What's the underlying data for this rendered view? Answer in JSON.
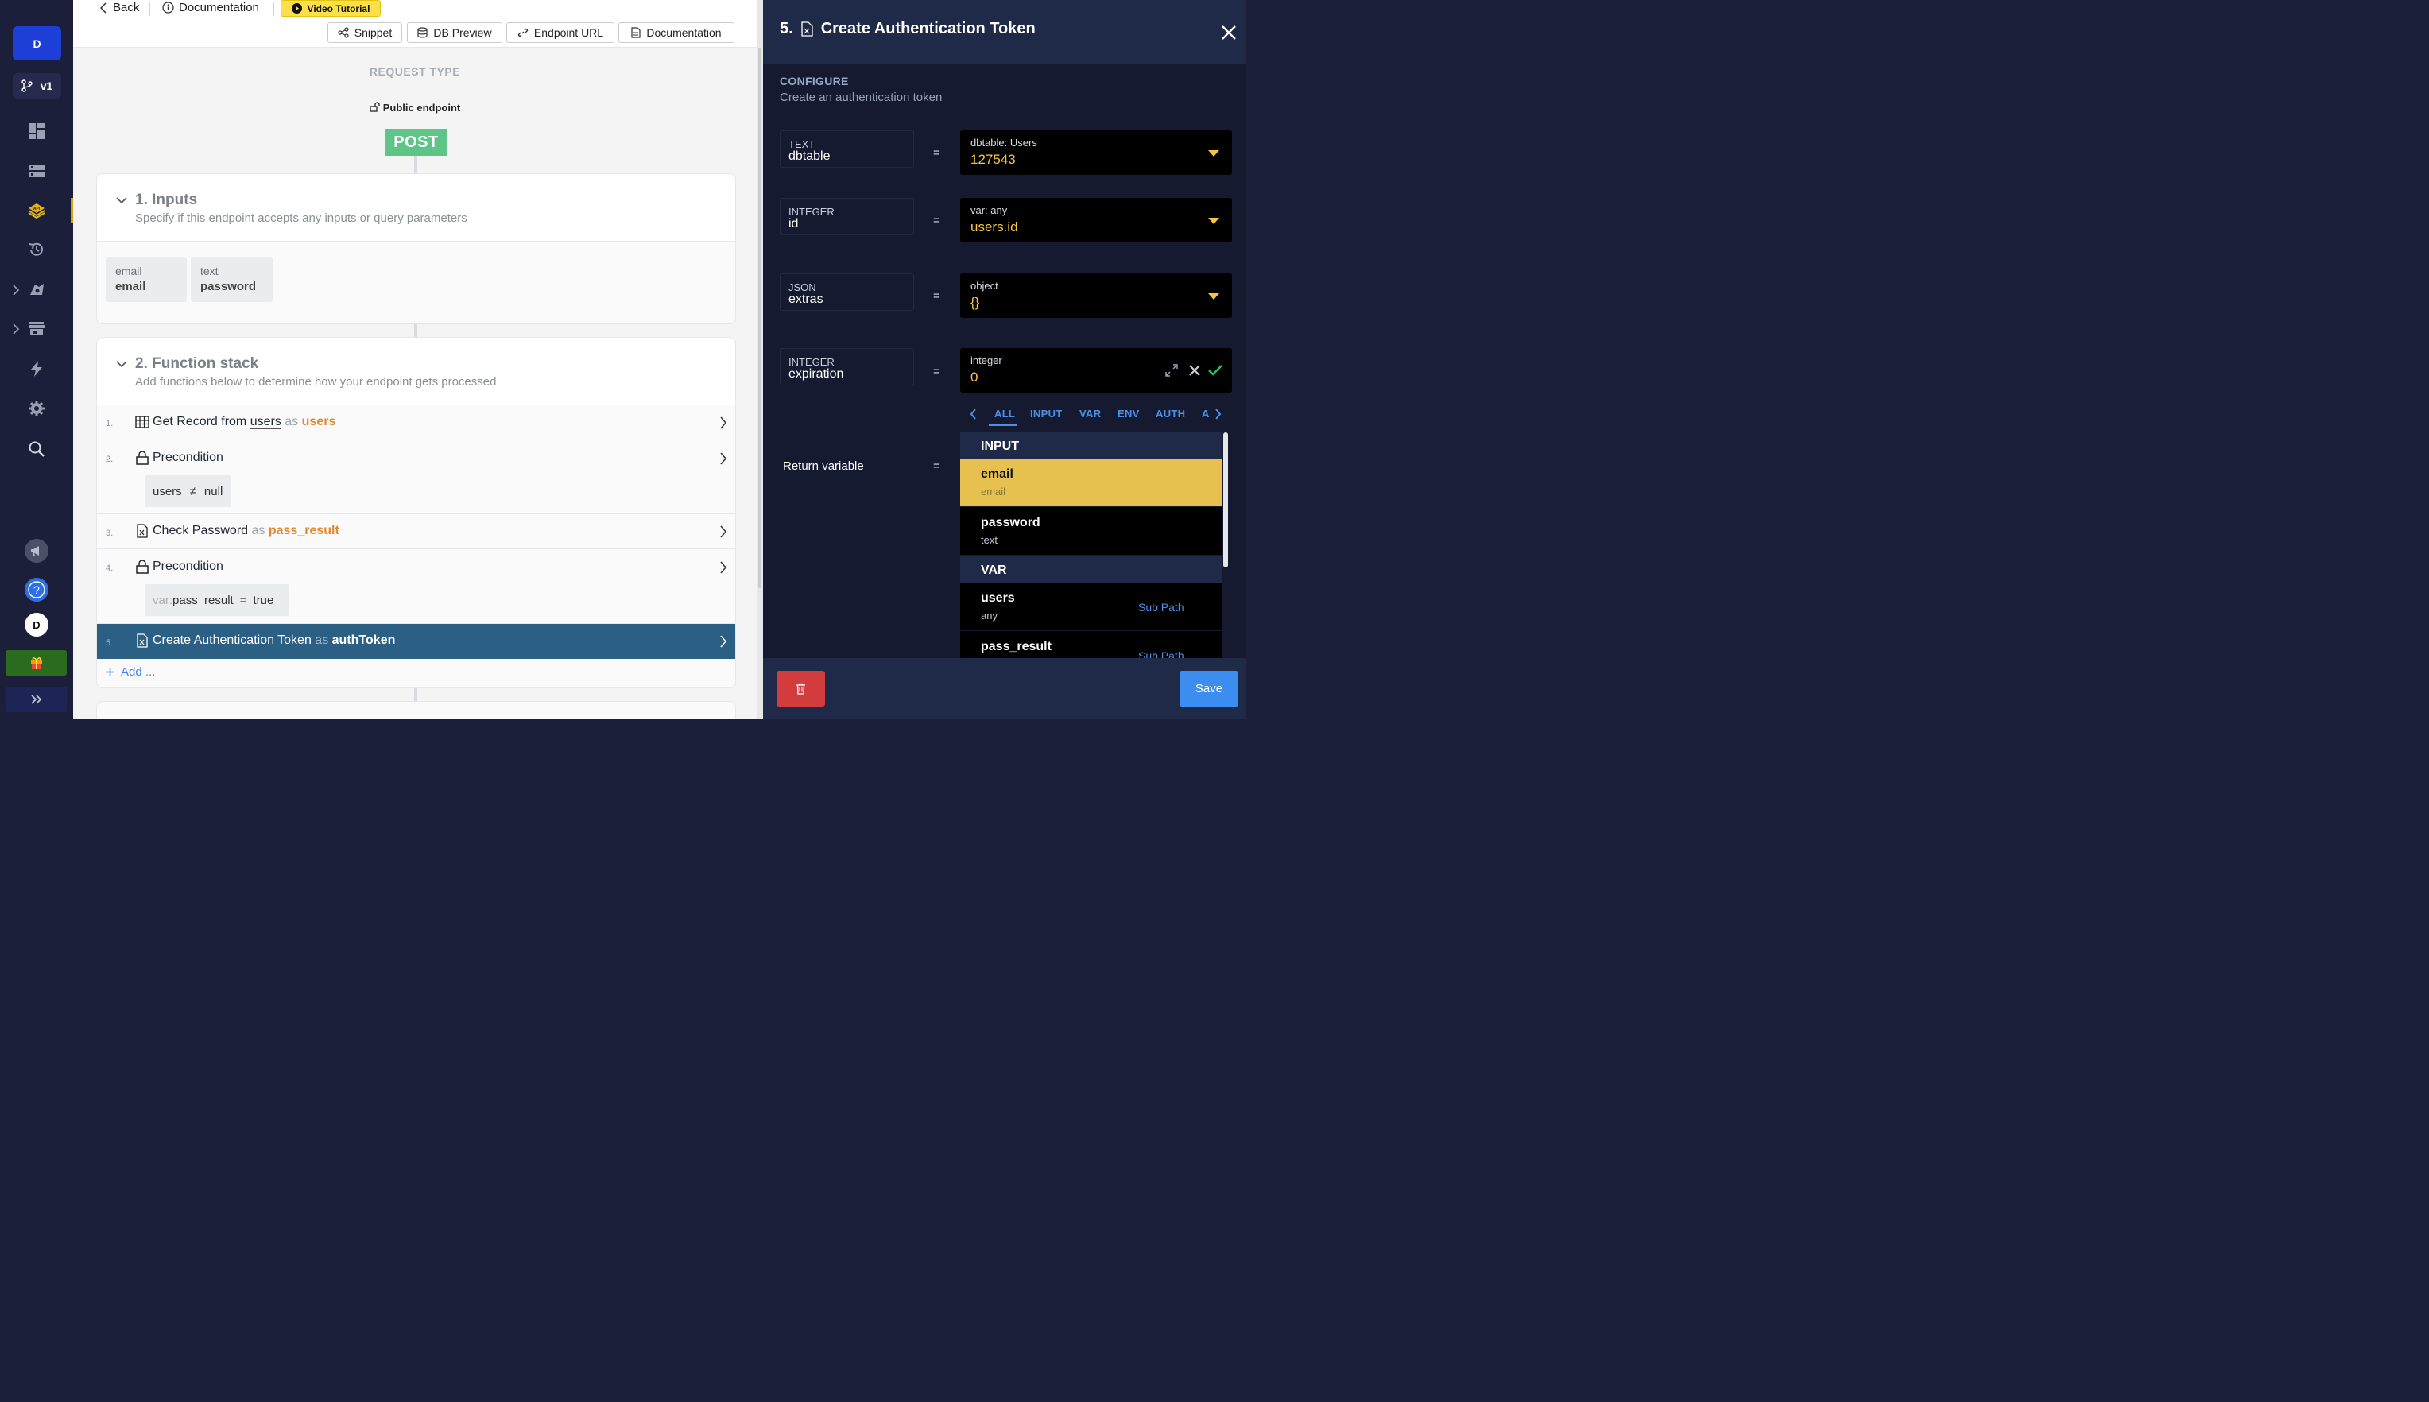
{
  "rail": {
    "avatar_initial": "D",
    "branch_label": "v1",
    "icons": [
      "dashboard-icon",
      "database-icon",
      "api-icon",
      "history-icon",
      "addons-icon",
      "marketplace-icon",
      "bolt-icon",
      "settings-icon",
      "search-icon"
    ],
    "active_icon": "api-icon",
    "help_icon": "?",
    "user_initial": "D",
    "accent_color": "#d4a017"
  },
  "toolbar": {
    "back_label": "Back",
    "documentation_label": "Documentation",
    "video_label": "Video Tutorial",
    "snippet_label": "Snippet",
    "db_preview_label": "DB Preview",
    "endpoint_url_label": "Endpoint URL",
    "documentation2_label": "Documentation"
  },
  "request": {
    "type_label": "REQUEST TYPE",
    "access_label": "Public endpoint",
    "method": "POST",
    "method_color": "#5fc487"
  },
  "inputs_card": {
    "title": "1. Inputs",
    "subtitle": "Specify if this endpoint accepts any inputs or query parameters",
    "inputs": [
      {
        "type": "email",
        "name": "email"
      },
      {
        "type": "text",
        "name": "password"
      }
    ]
  },
  "function_stack": {
    "title": "2. Function stack",
    "subtitle": "Add functions below to determine how your endpoint gets processed",
    "items": [
      {
        "num": "1.",
        "prefix": "Get Record from ",
        "target": "users",
        "as": "as",
        "alias": "users"
      },
      {
        "num": "2.",
        "label": "Precondition",
        "cond_left": "users",
        "cond_op": "≠",
        "cond_right": "null"
      },
      {
        "num": "3.",
        "label": "Check Password",
        "as": "as",
        "alias": "pass_result"
      },
      {
        "num": "4.",
        "label": "Precondition",
        "cond_prefix": "var:",
        "cond_left": "pass_result",
        "cond_op": "=",
        "cond_right": "true"
      },
      {
        "num": "5.",
        "label": "Create Authentication Token",
        "as": "as",
        "alias": "authToken"
      }
    ],
    "add_label": "Add ..."
  },
  "panel": {
    "title_num": "5.",
    "title": "Create Authentication Token",
    "configure_label": "CONFIGURE",
    "configure_sub": "Create an authentication token",
    "params": [
      {
        "type": "TEXT",
        "name": "dbtable",
        "eq": "=",
        "field_sub": "dbtable: Users",
        "field_val": "127543"
      },
      {
        "type": "INTEGER",
        "name": "id",
        "eq": "=",
        "field_sub": "var: any",
        "field_val": "users.id"
      },
      {
        "type": "JSON",
        "name": "extras",
        "eq": "=",
        "field_sub": "object",
        "field_val": "{}"
      },
      {
        "type": "INTEGER",
        "name": "expiration",
        "eq": "=",
        "field_sub": "integer",
        "field_val": "0"
      }
    ],
    "return_label": "Return variable",
    "return_eq": "=",
    "picker": {
      "tabs": [
        "ALL",
        "INPUT",
        "VAR",
        "ENV",
        "AUTH",
        "A"
      ],
      "active_tab": "ALL",
      "sections": [
        {
          "title": "INPUT",
          "items": [
            {
              "name": "email",
              "type": "email",
              "selected": true
            },
            {
              "name": "password",
              "type": "text"
            }
          ]
        },
        {
          "title": "VAR",
          "items": [
            {
              "name": "users",
              "type": "any",
              "action": "Sub Path"
            },
            {
              "name": "pass_result",
              "type": "",
              "action": "Sub Path"
            }
          ]
        }
      ]
    },
    "save_label": "Save",
    "delete_color": "#d23c3c",
    "save_color": "#3b8ef0"
  }
}
